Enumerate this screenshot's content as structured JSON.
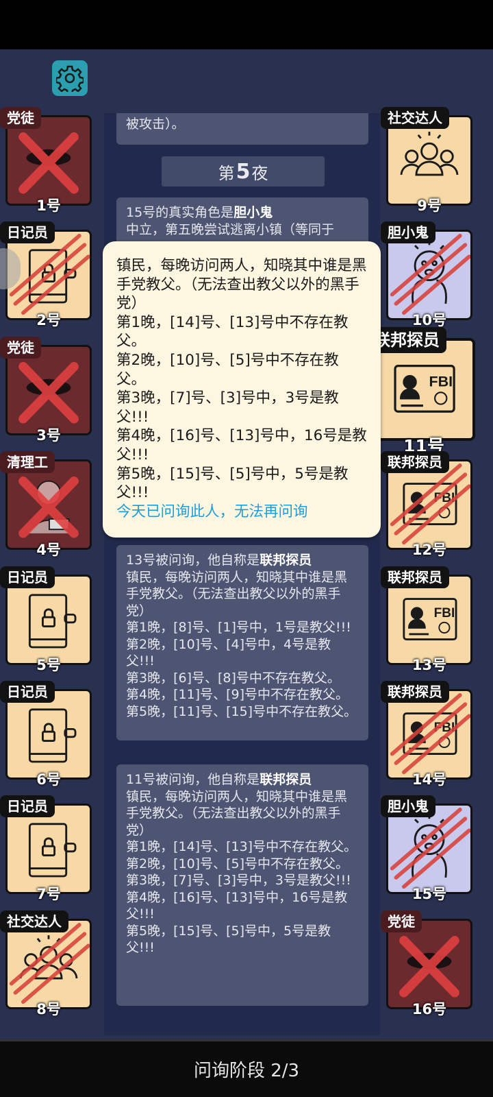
{
  "night": {
    "prefix": "第",
    "number": "5",
    "suffix": "夜"
  },
  "top_message": {
    "text": "被攻击）。"
  },
  "coward_message": {
    "line1_pre": "15号的真实角色是",
    "line1_bold": "胆小鬼",
    "line2": "中立，第五晚尝试逃离小镇（等同于"
  },
  "popup": {
    "lines": [
      "镇民，每晚访问两人，知晓其中谁是黑手党教父。（无法查出教父以外的黑手党）",
      "第1晚，[14]号、[13]号中不存在教父。",
      "第2晚，[10]号、[5]号中不存在教父。",
      "第3晚，[7]号、[3]号中，3号是教父!!!",
      "第4晚，[16]号、[13]号中，16号是教父!!!",
      "第5晚，[15]号、[5]号中，5号是教父!!!"
    ],
    "hint": "今天已问询此人，无法再问询"
  },
  "msg13": {
    "head_pre": "13号被问询，他自称是",
    "head_bold": "联邦探员",
    "lines": [
      "镇民，每晚访问两人，知晓其中谁是黑手党教父。（无法查出教父以外的黑手党）",
      "第1晚，[8]号、[1]号中，1号是教父!!!",
      "第2晚，[10]号、[4]号中，4号是教父!!!",
      "第3晚，[6]号、[8]号中不存在教父。",
      "第4晚，[11]号、[9]号中不存在教父。",
      "第5晚，[11]号、[15]号中不存在教父。"
    ]
  },
  "msg11": {
    "head_pre": "11号被问询，他自称是",
    "head_bold": "联邦探员",
    "lines": [
      "镇民，每晚访问两人，知晓其中谁是黑手党教父。（无法查出教父以外的黑手党）",
      "第1晚，[14]号、[13]号中不存在教父。",
      "第2晚，[10]号、[5]号中不存在教父。",
      "第3晚，[7]号、[3]号中，3号是教父!!!",
      "第4晚，[16]号、[13]号中，16号是教父!!!",
      "第5晚，[15]号、[5]号中，5号是教父!!!"
    ]
  },
  "players_left": [
    {
      "role": "党徒",
      "num": "1号",
      "icon": "mafia-hat-icon",
      "dead": true,
      "evil": true
    },
    {
      "role": "日记员",
      "num": "2号",
      "icon": "diary-lock-icon",
      "dead": true
    },
    {
      "role": "党徒",
      "num": "3号",
      "icon": "mafia-hat-icon",
      "dead": true,
      "evil": true
    },
    {
      "role": "清理工",
      "num": "4号",
      "icon": "cleaner-icon",
      "dead": true,
      "evil": true
    },
    {
      "role": "日记员",
      "num": "5号",
      "icon": "diary-lock-icon"
    },
    {
      "role": "日记员",
      "num": "6号",
      "icon": "diary-lock-icon"
    },
    {
      "role": "日记员",
      "num": "7号",
      "icon": "diary-lock-icon"
    },
    {
      "role": "社交达人",
      "num": "8号",
      "icon": "socialite-icon",
      "dead": true
    }
  ],
  "players_right": [
    {
      "role": "社交达人",
      "num": "9号",
      "icon": "socialite-icon"
    },
    {
      "role": "胆小鬼",
      "num": "10号",
      "icon": "coward-icon",
      "dead": true,
      "coward": true
    },
    {
      "role": "联邦探员",
      "num": "11号",
      "icon": "fbi-badge-icon",
      "selected": true
    },
    {
      "role": "联邦探员",
      "num": "12号",
      "icon": "fbi-badge-icon",
      "dead": true
    },
    {
      "role": "联邦探员",
      "num": "13号",
      "icon": "fbi-badge-icon"
    },
    {
      "role": "联邦探员",
      "num": "14号",
      "icon": "fbi-badge-icon",
      "dead": true
    },
    {
      "role": "胆小鬼",
      "num": "15号",
      "icon": "coward-icon",
      "dead": true,
      "coward": true
    },
    {
      "role": "党徒",
      "num": "16号",
      "icon": "mafia-hat-icon",
      "dead": true,
      "evil": true
    }
  ],
  "phase": {
    "text": "问询阶段 2/3"
  }
}
